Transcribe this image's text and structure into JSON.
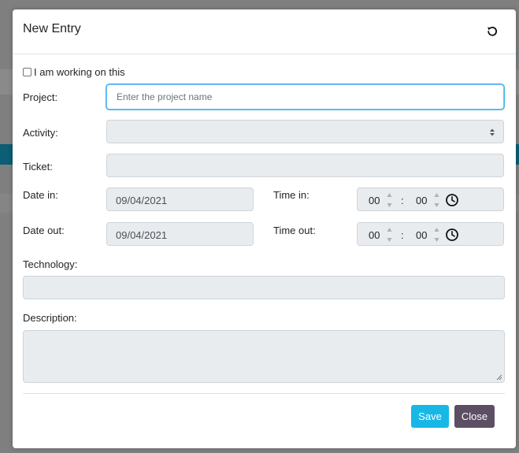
{
  "modal": {
    "title": "New Entry",
    "reset_icon": "undo-icon"
  },
  "form": {
    "working_checkbox": {
      "label": "I am working on this",
      "checked": false
    },
    "project": {
      "label": "Project:",
      "placeholder": "Enter the project name",
      "value": ""
    },
    "activity": {
      "label": "Activity:",
      "value": ""
    },
    "ticket": {
      "label": "Ticket:",
      "value": ""
    },
    "date_in": {
      "label": "Date in:",
      "value": "09/04/2021"
    },
    "time_in": {
      "label": "Time in:",
      "hours": "00",
      "separator": ":",
      "minutes": "00"
    },
    "date_out": {
      "label": "Date out:",
      "value": "09/04/2021"
    },
    "time_out": {
      "label": "Time out:",
      "hours": "00",
      "separator": ":",
      "minutes": "00"
    },
    "technology": {
      "label": "Technology:",
      "value": ""
    },
    "description": {
      "label": "Description:",
      "value": ""
    }
  },
  "footer": {
    "save_label": "Save",
    "close_label": "Close"
  },
  "colors": {
    "save": "#17b8e6",
    "close": "#5c4e63",
    "focus": "#3bb6e0"
  }
}
